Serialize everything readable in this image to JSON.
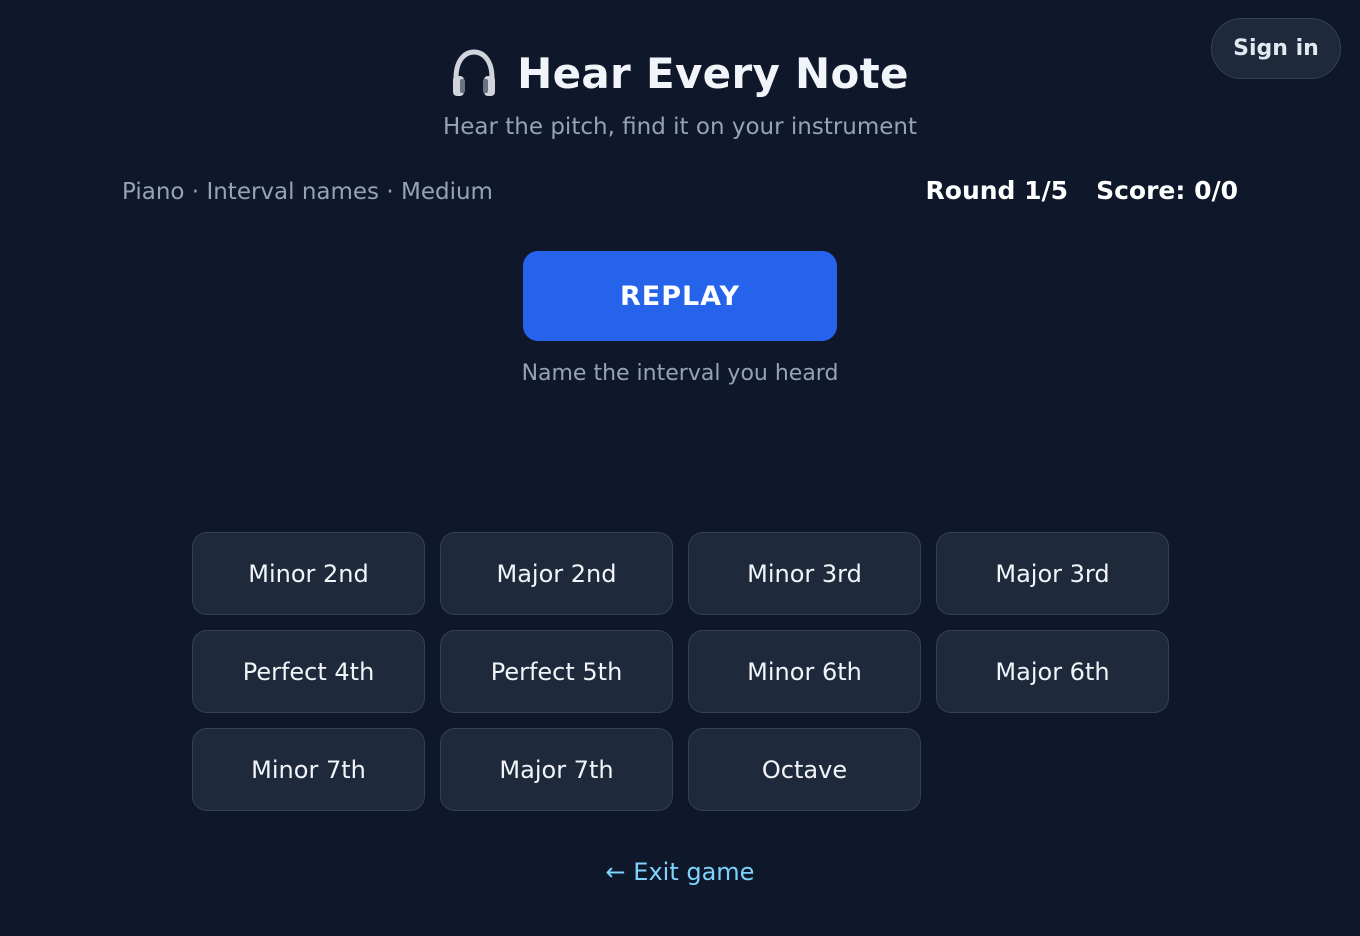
{
  "header": {
    "title": "Hear Every Note",
    "subtitle": "Hear the pitch, find it on your instrument",
    "icon": "headphones-icon"
  },
  "auth": {
    "signin_label": "Sign in"
  },
  "settings": {
    "instrument": "Piano",
    "separator": " · ",
    "mode": "Interval names",
    "difficulty": "Medium"
  },
  "status": {
    "round": "Round 1/5",
    "score": "Score: 0/0"
  },
  "replay": {
    "label": "REPLAY"
  },
  "instruction": "Name the interval you heard",
  "answers": [
    "Minor 2nd",
    "Major 2nd",
    "Minor 3rd",
    "Major 3rd",
    "Perfect 4th",
    "Perfect 5th",
    "Minor 6th",
    "Major 6th",
    "Minor 7th",
    "Major 7th",
    "Octave"
  ],
  "exit": {
    "label": "← Exit game"
  },
  "colors": {
    "background": "#0f172a",
    "accent": "#2563eb",
    "button_bg": "#1e293b",
    "button_border": "#334155",
    "muted_text": "#94a3b8",
    "link": "#7dd3fc"
  }
}
